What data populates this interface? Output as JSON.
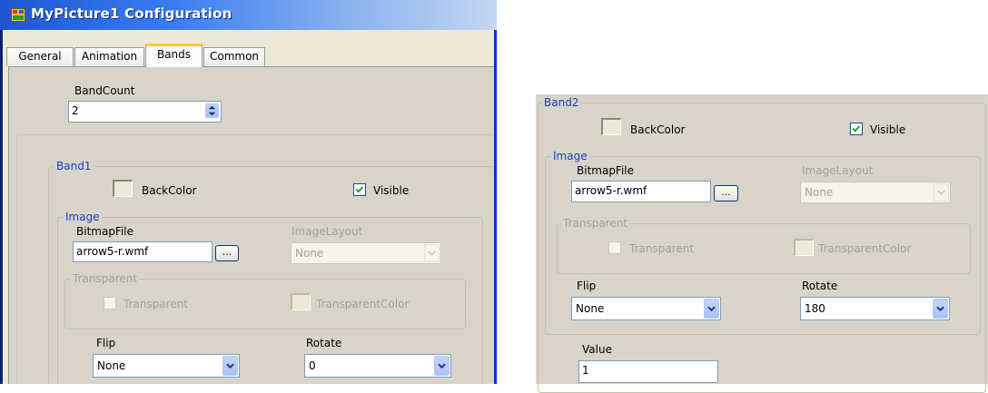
{
  "window": {
    "title": "MyPicture1 Configuration",
    "tabs": [
      {
        "label": "General",
        "active": false
      },
      {
        "label": "Animation",
        "active": false
      },
      {
        "label": "Bands",
        "active": true
      },
      {
        "label": "Common",
        "active": false
      }
    ]
  },
  "band_count": {
    "label": "BandCount",
    "value": "2"
  },
  "band1": {
    "title": "Band1",
    "backcolor_label": "BackColor",
    "visible_label": "Visible",
    "visible_checked": true,
    "image": {
      "title": "Image",
      "bitmapfile_label": "BitmapFile",
      "bitmapfile_value": "arrow5-r.wmf",
      "browse_label": "...",
      "imagelayout_label": "ImageLayout",
      "imagelayout_value": "None"
    },
    "transparent": {
      "title": "Transparent",
      "transparent_label": "Transparent",
      "transparent_checked": false,
      "transparentcolor_label": "TransparentColor"
    },
    "flip_label": "Flip",
    "flip_value": "None",
    "rotate_label": "Rotate",
    "rotate_value": "0"
  },
  "band2": {
    "title": "Band2",
    "backcolor_label": "BackColor",
    "visible_label": "Visible",
    "visible_checked": true,
    "image": {
      "title": "Image",
      "bitmapfile_label": "BitmapFile",
      "bitmapfile_value": "arrow5-r.wmf",
      "browse_label": "...",
      "imagelayout_label": "ImageLayout",
      "imagelayout_value": "None"
    },
    "transparent": {
      "title": "Transparent",
      "transparent_label": "Transparent",
      "transparent_checked": false,
      "transparentcolor_label": "TransparentColor"
    },
    "flip_label": "Flip",
    "flip_value": "None",
    "rotate_label": "Rotate",
    "rotate_value": "180",
    "value_label": "Value",
    "value": "1"
  },
  "colors": {
    "titlebar_start": "#1d56cf",
    "dialog_bg": "#ece9d8",
    "panel_bg": "#d8d4c9",
    "group_title": "#1a3dc1",
    "disabled_text": "#a19f96",
    "check_mark": "#21a121"
  },
  "icons": [
    "app-icon",
    "spin-updown-icon",
    "chevron-down-icon",
    "checkmark-icon"
  ]
}
